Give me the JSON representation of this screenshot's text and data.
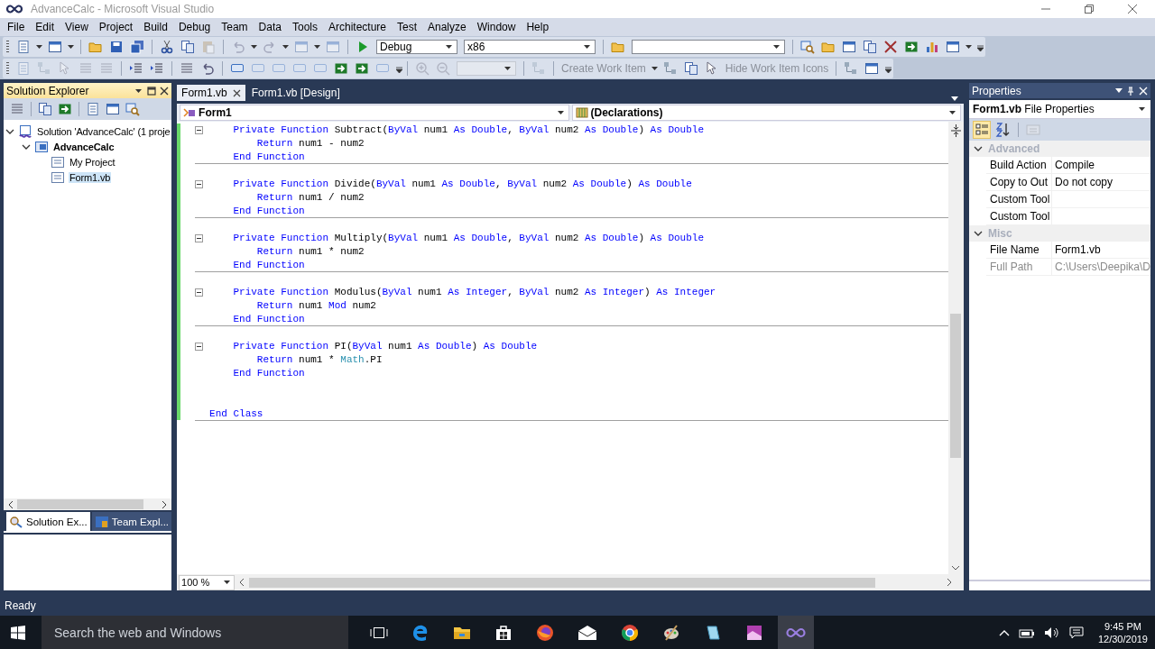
{
  "window": {
    "title": "AdvanceCalc - Microsoft Visual Studio"
  },
  "menu": [
    "File",
    "Edit",
    "View",
    "Project",
    "Build",
    "Debug",
    "Team",
    "Data",
    "Tools",
    "Architecture",
    "Test",
    "Analyze",
    "Window",
    "Help"
  ],
  "toolbar": {
    "configuration": "Debug",
    "platform": "x86"
  },
  "toolbar2": [
    {
      "label": "Create Work Item",
      "disabled": true
    },
    {
      "label": "Hide Work Item Icons",
      "disabled": true
    }
  ],
  "solution_explorer": {
    "title": "Solution Explorer",
    "tree": [
      {
        "label": "Solution 'AdvanceCalc' (1 proje",
        "bold": false,
        "selected": false,
        "expanded": true,
        "children": [
          {
            "label": "AdvanceCalc",
            "bold": true,
            "selected": false,
            "expanded": true,
            "children": [
              {
                "label": "My Project",
                "bold": false,
                "selected": false
              },
              {
                "label": "Form1.vb",
                "bold": false,
                "selected": true
              }
            ]
          }
        ]
      }
    ],
    "tabs": [
      {
        "label": "Solution Ex...",
        "selected": true
      },
      {
        "label": "Team Expl...",
        "selected": false
      }
    ]
  },
  "editor": {
    "tabs": [
      {
        "label": "Form1.vb",
        "selected": true
      },
      {
        "label": "Form1.vb [Design]",
        "selected": false
      }
    ],
    "class_dropdown": "Form1",
    "member_dropdown": "(Declarations)",
    "zoom": "100 %",
    "lines": [
      {
        "fold": true,
        "separator": false,
        "segments": [
          {
            "text": "    Private Function",
            "kind": "keyword"
          },
          {
            "text": " Subtract(",
            "kind": "plain"
          },
          {
            "text": "ByVal",
            "kind": "keyword"
          },
          {
            "text": " num1 ",
            "kind": "plain"
          },
          {
            "text": "As Double",
            "kind": "keyword"
          },
          {
            "text": ", ",
            "kind": "plain"
          },
          {
            "text": "ByVal",
            "kind": "keyword"
          },
          {
            "text": " num2 ",
            "kind": "plain"
          },
          {
            "text": "As Double",
            "kind": "keyword"
          },
          {
            "text": ") ",
            "kind": "plain"
          },
          {
            "text": "As Double",
            "kind": "keyword"
          }
        ]
      },
      {
        "fold": false,
        "separator": false,
        "segments": [
          {
            "text": "        Return",
            "kind": "keyword"
          },
          {
            "text": " num1 - num2",
            "kind": "plain"
          }
        ]
      },
      {
        "fold": false,
        "separator": true,
        "segments": [
          {
            "text": "    End Function",
            "kind": "keyword"
          }
        ]
      },
      {
        "fold": false,
        "separator": false
      },
      {
        "fold": true,
        "separator": false,
        "segments": [
          {
            "text": "    Private Function",
            "kind": "keyword"
          },
          {
            "text": " Divide(",
            "kind": "plain"
          },
          {
            "text": "ByVal",
            "kind": "keyword"
          },
          {
            "text": " num1 ",
            "kind": "plain"
          },
          {
            "text": "As Double",
            "kind": "keyword"
          },
          {
            "text": ", ",
            "kind": "plain"
          },
          {
            "text": "ByVal",
            "kind": "keyword"
          },
          {
            "text": " num2 ",
            "kind": "plain"
          },
          {
            "text": "As Double",
            "kind": "keyword"
          },
          {
            "text": ") ",
            "kind": "plain"
          },
          {
            "text": "As Double",
            "kind": "keyword"
          }
        ]
      },
      {
        "fold": false,
        "separator": false,
        "segments": [
          {
            "text": "        Return",
            "kind": "keyword"
          },
          {
            "text": " num1 / num2",
            "kind": "plain"
          }
        ]
      },
      {
        "fold": false,
        "separator": true,
        "segments": [
          {
            "text": "    End Function",
            "kind": "keyword"
          }
        ]
      },
      {
        "fold": false,
        "separator": false
      },
      {
        "fold": true,
        "separator": false,
        "segments": [
          {
            "text": "    Private Function",
            "kind": "keyword"
          },
          {
            "text": " Multiply(",
            "kind": "plain"
          },
          {
            "text": "ByVal",
            "kind": "keyword"
          },
          {
            "text": " num1 ",
            "kind": "plain"
          },
          {
            "text": "As Double",
            "kind": "keyword"
          },
          {
            "text": ", ",
            "kind": "plain"
          },
          {
            "text": "ByVal",
            "kind": "keyword"
          },
          {
            "text": " num2 ",
            "kind": "plain"
          },
          {
            "text": "As Double",
            "kind": "keyword"
          },
          {
            "text": ") ",
            "kind": "plain"
          },
          {
            "text": "As Double",
            "kind": "keyword"
          }
        ]
      },
      {
        "fold": false,
        "separator": false,
        "segments": [
          {
            "text": "        Return",
            "kind": "keyword"
          },
          {
            "text": " num1 * num2",
            "kind": "plain"
          }
        ]
      },
      {
        "fold": false,
        "separator": true,
        "segments": [
          {
            "text": "    End Function",
            "kind": "keyword"
          }
        ]
      },
      {
        "fold": false,
        "separator": false
      },
      {
        "fold": true,
        "separator": false,
        "segments": [
          {
            "text": "    Private Function",
            "kind": "keyword"
          },
          {
            "text": " Modulus(",
            "kind": "plain"
          },
          {
            "text": "ByVal",
            "kind": "keyword"
          },
          {
            "text": " num1 ",
            "kind": "plain"
          },
          {
            "text": "As Integer",
            "kind": "keyword"
          },
          {
            "text": ", ",
            "kind": "plain"
          },
          {
            "text": "ByVal",
            "kind": "keyword"
          },
          {
            "text": " num2 ",
            "kind": "plain"
          },
          {
            "text": "As Integer",
            "kind": "keyword"
          },
          {
            "text": ") ",
            "kind": "plain"
          },
          {
            "text": "As Integer",
            "kind": "keyword"
          }
        ]
      },
      {
        "fold": false,
        "separator": false,
        "segments": [
          {
            "text": "        Return",
            "kind": "keyword"
          },
          {
            "text": " num1 ",
            "kind": "plain"
          },
          {
            "text": "Mod",
            "kind": "keyword"
          },
          {
            "text": " num2",
            "kind": "plain"
          }
        ]
      },
      {
        "fold": false,
        "separator": true,
        "segments": [
          {
            "text": "    End Function",
            "kind": "keyword"
          }
        ]
      },
      {
        "fold": false,
        "separator": false
      },
      {
        "fold": true,
        "separator": false,
        "segments": [
          {
            "text": "    Private Function",
            "kind": "keyword"
          },
          {
            "text": " PI(",
            "kind": "plain"
          },
          {
            "text": "ByVal",
            "kind": "keyword"
          },
          {
            "text": " num1 ",
            "kind": "plain"
          },
          {
            "text": "As Double",
            "kind": "keyword"
          },
          {
            "text": ") ",
            "kind": "plain"
          },
          {
            "text": "As Double",
            "kind": "keyword"
          }
        ]
      },
      {
        "fold": false,
        "separator": false,
        "segments": [
          {
            "text": "        Return",
            "kind": "keyword"
          },
          {
            "text": " num1 * ",
            "kind": "plain"
          },
          {
            "text": "Math",
            "kind": "type"
          },
          {
            "text": ".PI",
            "kind": "plain"
          }
        ]
      },
      {
        "fold": false,
        "separator": false,
        "segments": [
          {
            "text": "    End Function",
            "kind": "keyword"
          }
        ]
      },
      {
        "fold": false,
        "separator": false
      },
      {
        "fold": false,
        "separator": false
      },
      {
        "fold": false,
        "separator": true,
        "segments": [
          {
            "text": "End Class",
            "kind": "keyword"
          }
        ]
      }
    ]
  },
  "properties": {
    "title": "Properties",
    "object_name": "Form1.vb",
    "object_type": "File Properties",
    "categories": [
      {
        "name": "Advanced",
        "expanded": true,
        "rows": [
          {
            "name": "Build Action",
            "value": "Compile",
            "disabled": false
          },
          {
            "name": "Copy to Out",
            "value": "Do not copy",
            "disabled": false
          },
          {
            "name": "Custom Tool",
            "disabled": false
          },
          {
            "name": "Custom Tool",
            "disabled": false
          }
        ]
      },
      {
        "name": "Misc",
        "expanded": true,
        "rows": [
          {
            "name": "File Name",
            "value": "Form1.vb",
            "disabled": false
          },
          {
            "name": "Full Path",
            "value": "C:\\Users\\Deepika\\D",
            "disabled": true
          }
        ]
      }
    ]
  },
  "status_bar": "Ready",
  "taskbar": {
    "search_placeholder": "Search the web and Windows",
    "time": "9:45 PM",
    "date": "12/30/2019"
  }
}
